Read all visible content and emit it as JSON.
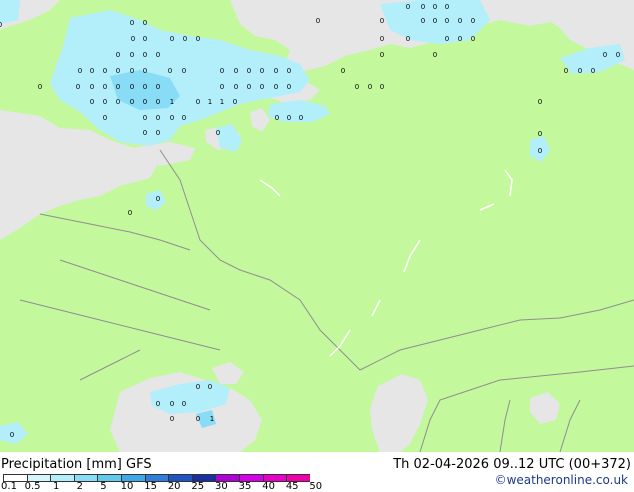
{
  "header": {
    "title_left": "Precipitation [mm] GFS",
    "title_right": "Th 02-04-2026 09..12 UTC (00+372)",
    "credit": "©weatheronline.co.uk"
  },
  "colors": {
    "land": "#c3f89d",
    "sea": "#e6e6e6",
    "border": "#8f8f8f",
    "rain_light": "#b3eefb",
    "rain_med": "#88dcf5"
  },
  "legend": {
    "ticks": [
      "0.1",
      "0.5",
      "1",
      "2",
      "5",
      "10",
      "15",
      "20",
      "25",
      "30",
      "35",
      "40",
      "45",
      "50"
    ],
    "colors": [
      "#ffffff",
      "#d4f5fb",
      "#b3eefb",
      "#88dcf5",
      "#62c8f0",
      "#3fa8e8",
      "#2e7fd8",
      "#1f55c0",
      "#1a2fa0",
      "#b000d8",
      "#d400e8",
      "#e800c8",
      "#f000a8"
    ]
  },
  "map_labels": {
    "markers": [
      "0",
      "1"
    ]
  }
}
